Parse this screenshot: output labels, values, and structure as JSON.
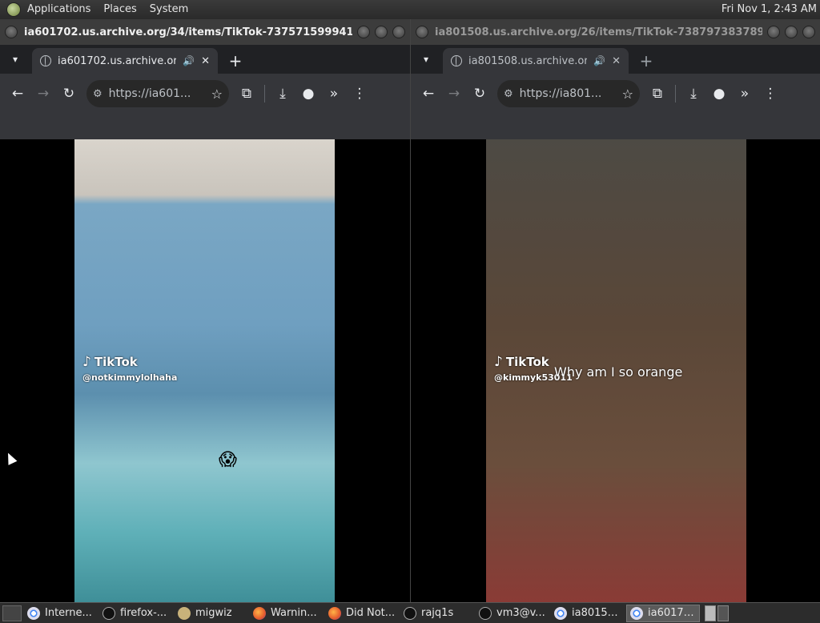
{
  "top_panel": {
    "menus": [
      "Applications",
      "Places",
      "System"
    ],
    "clock": "Fri Nov  1,  2:43 AM"
  },
  "left_window": {
    "title": "ia601702.us.archive.org/34/items/TikTok-737571599941430...",
    "tab_label": "ia601702.us.archive.org/3",
    "url": "https://ia601...",
    "watermark_brand": "TikTok",
    "watermark_user": "@notkimmylolhaha",
    "emoji": "😱"
  },
  "right_window": {
    "title": "ia801508.us.archive.org/26/items/TikTok-738797383789324...",
    "tab_label": "ia801508.us.archive.org/",
    "url": "https://ia801...",
    "watermark_brand": "TikTok",
    "watermark_user": "@kimmyk53011",
    "caption": "Why am I so orange"
  },
  "taskbar": {
    "tasks": [
      {
        "label": "Interne...",
        "icon": "chrome-icon"
      },
      {
        "label": "firefox-...",
        "icon": "terminal-icon"
      },
      {
        "label": "migwiz",
        "icon": "folder-icon"
      },
      {
        "label": "Warnin...",
        "icon": "firefox-icon"
      },
      {
        "label": "Did Not...",
        "icon": "firefox-icon"
      },
      {
        "label": "rajq1s",
        "icon": "terminal-icon"
      },
      {
        "label": "vm3@v...",
        "icon": "terminal-icon"
      },
      {
        "label": "ia80150...",
        "icon": "chrome-icon"
      },
      {
        "label": "ia60170...",
        "icon": "chrome-icon"
      }
    ]
  }
}
